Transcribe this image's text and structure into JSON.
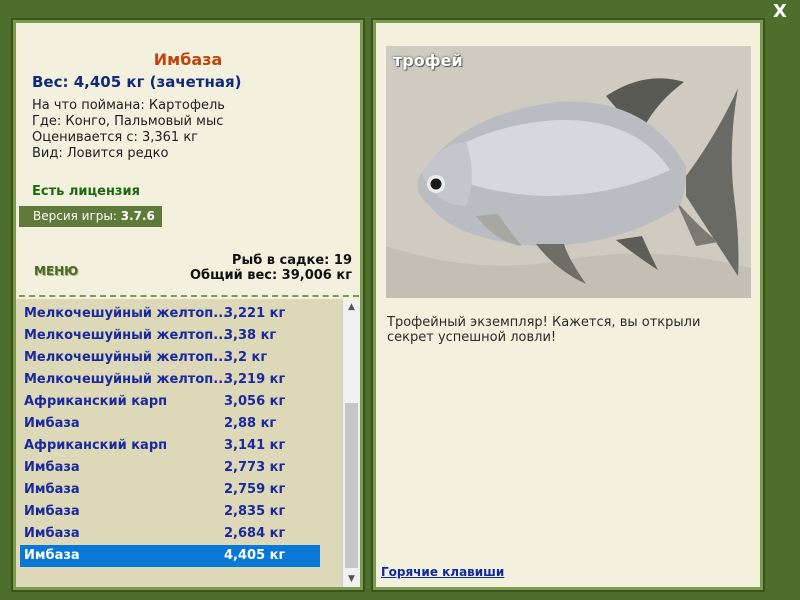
{
  "window": {
    "close_label": "X"
  },
  "fish": {
    "name": "Имбаза",
    "weight_line": "Вес: 4,405 кг (зачетная)",
    "caught_on": "На что поймана: Картофель",
    "location": "Где: Конго, Пальмовый мыс",
    "rated_from": "Оценивается с: 3,361 кг",
    "kind": "Вид: Ловится редко"
  },
  "license": "Есть лицензия",
  "version": {
    "label": "Версия игры:",
    "value": "3.7.6"
  },
  "menu_label": "МЕНЮ",
  "stats": {
    "count": "Рыб в садке: 19",
    "total": "Общий вес: 39,006 кг"
  },
  "catch_list": [
    {
      "name": "Мелкочешуйный желтоп...",
      "weight": "3,221 кг"
    },
    {
      "name": "Мелкочешуйный желтоп...",
      "weight": "3,38 кг"
    },
    {
      "name": "Мелкочешуйный желтоп...",
      "weight": "3,2 кг"
    },
    {
      "name": "Мелкочешуйный желтоп...",
      "weight": "3,219 кг"
    },
    {
      "name": "Африканский карп",
      "weight": "3,056 кг"
    },
    {
      "name": "Имбаза",
      "weight": "2,88 кг"
    },
    {
      "name": "Африканский карп",
      "weight": "3,141 кг"
    },
    {
      "name": "Имбаза",
      "weight": "2,773 кг"
    },
    {
      "name": "Имбаза",
      "weight": "2,759 кг"
    },
    {
      "name": "Имбаза",
      "weight": "2,835 кг"
    },
    {
      "name": "Имбаза",
      "weight": "2,684 кг"
    },
    {
      "name": "Имбаза",
      "weight": "4,405 кг",
      "selected": true
    }
  ],
  "photo": {
    "label": "трофей"
  },
  "description": "Трофейный экземпляр! Кажется, вы открыли секрет успешной ловли!",
  "hotkeys_label": "Горячие клавиши",
  "colors": {
    "background": "#4e6e2c",
    "panel": "#f3f1de",
    "fish_name": "#c0440e",
    "list_text": "#1a2a9e",
    "selected": "#0a78d6",
    "license": "#1a6a12"
  }
}
